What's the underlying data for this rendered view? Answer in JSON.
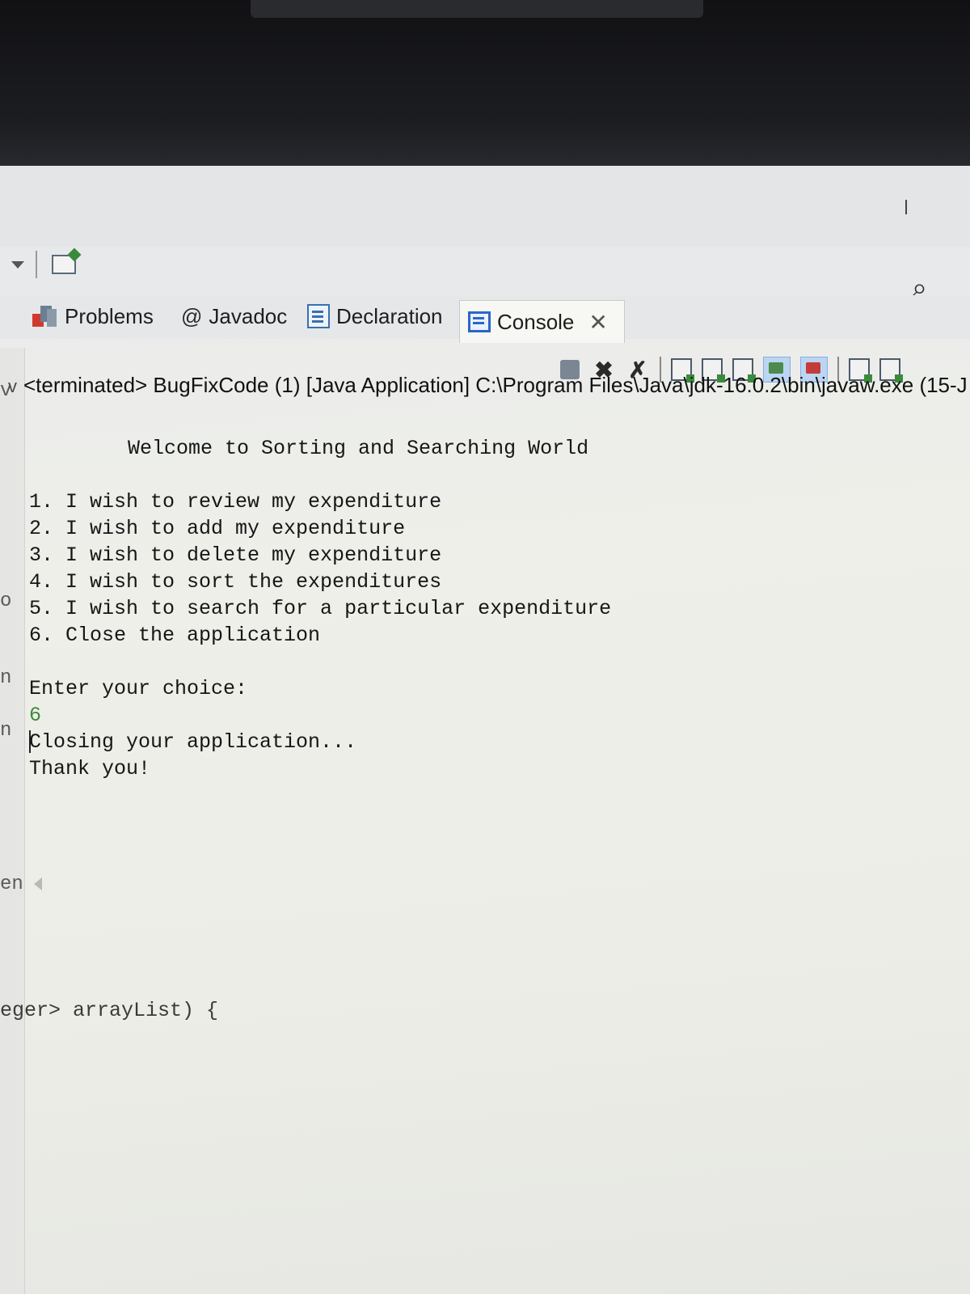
{
  "tabs": [
    {
      "label": "Problems",
      "icon": "problems-icon"
    },
    {
      "label": "Javadoc",
      "icon": "at-icon"
    },
    {
      "label": "Declaration",
      "icon": "declaration-icon"
    },
    {
      "label": "Console",
      "icon": "console-icon",
      "active": true
    }
  ],
  "console": {
    "header": "<terminated> BugFixCode (1) [Java Application] C:\\Program Files\\Java\\jdk-16.0.2\\bin\\javaw.exe (15-J",
    "welcome": "Welcome to Sorting and Searching World",
    "menu": [
      "1. I wish to review my expenditure",
      "2. I wish to add my expenditure",
      "3. I wish to delete my expenditure",
      "4. I wish to sort the expenditures",
      "5. I wish to search for a particular expenditure",
      "6. Close the application"
    ],
    "prompt": "Enter your choice:",
    "input_value": "6",
    "closing": "Closing your application...",
    "thanks": "Thank you!"
  },
  "gutter": {
    "c1": "v",
    "c2": "o",
    "c3": "n",
    "c4": "n",
    "c5": "en"
  },
  "editor": {
    "code_fragment": "eger> arrayList) {"
  },
  "colors": {
    "input_echo": "#3b8a3b",
    "console_icon": "#2a66c8",
    "stop": "#7b8694"
  }
}
